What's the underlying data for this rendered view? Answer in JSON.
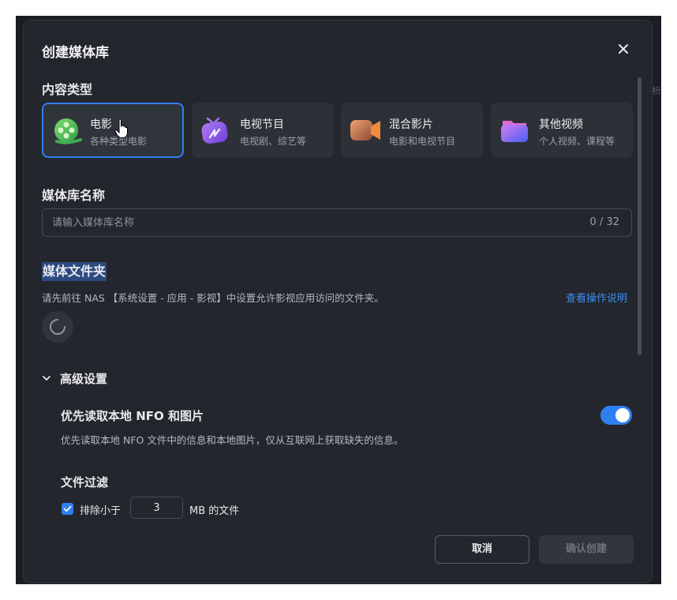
{
  "backdrop": {
    "fragment_text": "析"
  },
  "dialog": {
    "title": "创建媒体库",
    "close_icon": "close-icon"
  },
  "content_type": {
    "label": "内容类型",
    "cards": [
      {
        "name": "电影",
        "desc": "各种类型电影",
        "icon": "film-reel-icon",
        "selected": true
      },
      {
        "name": "电视节目",
        "desc": "电视剧、综艺等",
        "icon": "tv-icon",
        "selected": false
      },
      {
        "name": "混合影片",
        "desc": "电影和电视节目",
        "icon": "video-camera-icon",
        "selected": false
      },
      {
        "name": "其他视频",
        "desc": "个人视频、课程等",
        "icon": "folder-icon",
        "selected": false
      }
    ]
  },
  "library_name": {
    "label": "媒体库名称",
    "placeholder": "请输入媒体库名称",
    "value": "",
    "counter": "0 / 32"
  },
  "media_folder": {
    "label": "媒体文件夹",
    "hint": "请先前往 NAS 【系统设置 - 应用 - 影视】中设置允许影视应用访问的文件夹。",
    "help_link": "查看操作说明",
    "loading_icon": "spinner-icon"
  },
  "advanced": {
    "label": "高级设置",
    "expanded": true,
    "nfo_option": {
      "title": "优先读取本地 NFO 和图片",
      "desc": "优先读取本地 NFO 文件中的信息和本地图片，仅从互联网上获取缺失的信息。",
      "enabled": true
    },
    "file_filter": {
      "title": "文件过滤",
      "checkbox_label": "排除小于",
      "checked": true,
      "size_value": "3",
      "unit_label": "MB 的文件"
    }
  },
  "buttons": {
    "cancel": "取消",
    "confirm": "确认创建"
  },
  "colors": {
    "accent": "#2f7ff0",
    "dialog_bg": "#23262c",
    "link": "#3d8ef5"
  }
}
